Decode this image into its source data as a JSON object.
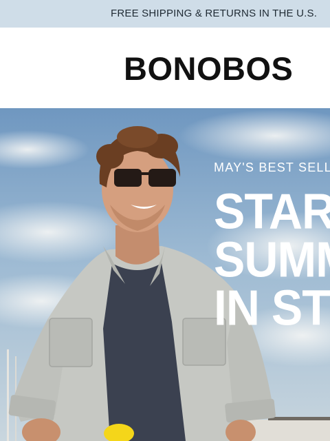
{
  "promo": {
    "text": "FREE SHIPPING & RETURNS IN THE U.S."
  },
  "header": {
    "logo": "BONOBOS"
  },
  "hero": {
    "eyebrow": "MAY'S BEST SELL",
    "headline_lines": [
      "START",
      "SUMM",
      "IN STY"
    ]
  },
  "colors": {
    "promo_bg": "#cfdde8",
    "sky": "#8fb1cf",
    "shirt": "#c9cbc6",
    "tshirt": "#3b4150"
  }
}
